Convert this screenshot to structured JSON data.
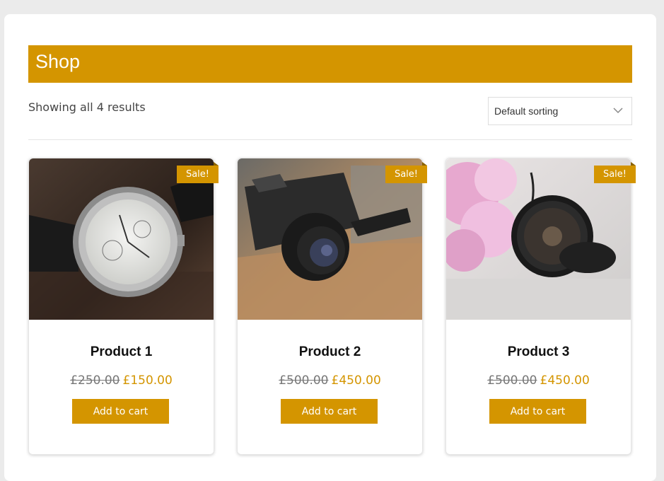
{
  "page": {
    "title": "Shop",
    "results_text": "Showing all 4 results",
    "sort_selected": "Default sorting"
  },
  "colors": {
    "accent": "#d49500",
    "background": "#ebebeb"
  },
  "products": [
    {
      "title": "Product 1",
      "badge": "Sale!",
      "old_price": "£250.00",
      "price": "£150.00",
      "button": "Add to cart",
      "image": "wristwatch-photo"
    },
    {
      "title": "Product 2",
      "badge": "Sale!",
      "old_price": "£500.00",
      "price": "£450.00",
      "button": "Add to cart",
      "image": "camera-photo"
    },
    {
      "title": "Product 3",
      "badge": "Sale!",
      "old_price": "£500.00",
      "price": "£450.00",
      "button": "Add to cart",
      "image": "pocket-watch-flowers-photo"
    }
  ]
}
